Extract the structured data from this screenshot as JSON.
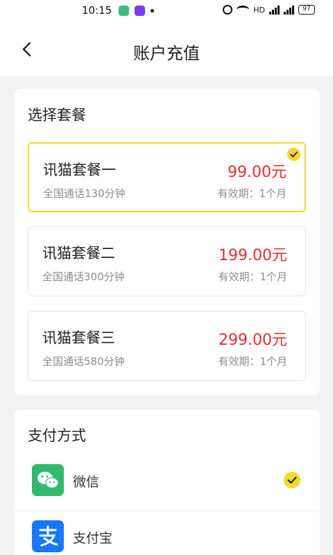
{
  "status_bar": {
    "time": "10:15",
    "network": "HD",
    "battery": "97"
  },
  "header": {
    "title": "账户充值"
  },
  "packages": {
    "section_title": "选择套餐",
    "items": [
      {
        "name": "讯猫套餐一",
        "desc": "全国通话130分钟",
        "price": "99.00元",
        "valid": "有效期：1个月",
        "selected": true
      },
      {
        "name": "讯猫套餐二",
        "desc": "全国通话300分钟",
        "price": "199.00元",
        "valid": "有效期：1个月",
        "selected": false
      },
      {
        "name": "讯猫套餐三",
        "desc": "全国通话580分钟",
        "price": "299.00元",
        "valid": "有效期：1个月",
        "selected": false
      }
    ]
  },
  "payment": {
    "section_title": "支付方式",
    "methods": [
      {
        "label": "微信",
        "icon": "wechat-icon",
        "selected": true
      },
      {
        "label": "支付宝",
        "icon": "alipay-icon",
        "selected": false
      }
    ]
  },
  "colors": {
    "accent_yellow": "#f4d82a",
    "price_red": "#e8302c",
    "wechat_green": "#2ebc6b",
    "alipay_blue": "#1677ff"
  }
}
